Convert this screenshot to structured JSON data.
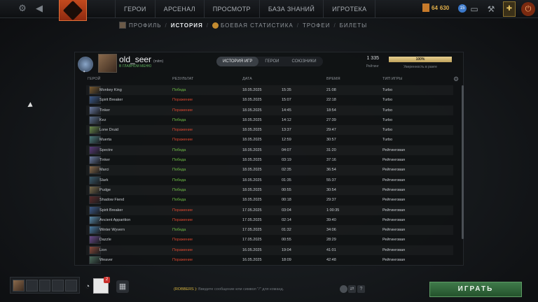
{
  "topbar": {
    "nav": [
      "ГЕРОИ",
      "АРСЕНАЛ",
      "ПРОСМОТР",
      "БАЗА ЗНАНИЙ",
      "ИГРОТЕКА"
    ],
    "gold_left": "64",
    "gold_right": "630",
    "level": "15"
  },
  "subnav": {
    "profile": "ПРОФИЛЬ",
    "history": "ИСТОРИЯ",
    "stats": "БОЕВАЯ СТАТИСТИКА",
    "trophies": "ТРОФЕИ",
    "tickets": "БИЛЕТЫ"
  },
  "profile": {
    "name": "old_seer",
    "tag": "(mitm)",
    "status": "В ГЛАВНОМ МЕНЮ",
    "rating_value": "1 335",
    "rating_label": "Рейтинг",
    "confidence_value": "100%",
    "confidence_fraction": 1.0,
    "confidence_label": "Уверенность в ранге"
  },
  "tabs": [
    "ИСТОРИЯ ИГР",
    "ГЕРОИ",
    "СОЮЗНИКИ"
  ],
  "table": {
    "headers": {
      "hero": "ГЕРОЙ",
      "result": "РЕЗУЛЬТАТ",
      "date": "ДАТА",
      "duration": "ВРЕМЯ",
      "type": "ТИП ИГРЫ"
    },
    "rows": [
      {
        "hero": "Monkey King",
        "result": "Победа",
        "win": true,
        "date": "18.05.2025",
        "time": "15:35",
        "duration": "21:08",
        "type": "Turbo",
        "color": "#7a5a2e"
      },
      {
        "hero": "Spirit Breaker",
        "result": "Поражение",
        "win": false,
        "date": "18.05.2025",
        "time": "15:07",
        "duration": "22:18",
        "type": "Turbo",
        "color": "#3c5a8a"
      },
      {
        "hero": "Tinker",
        "result": "Поражение",
        "win": false,
        "date": "18.05.2025",
        "time": "14:45",
        "duration": "18:54",
        "type": "Turbo",
        "color": "#6a7aa0"
      },
      {
        "hero": "Kez",
        "result": "Победа",
        "win": true,
        "date": "18.05.2025",
        "time": "14:12",
        "duration": "27:39",
        "type": "Turbo",
        "color": "#5a6c8a"
      },
      {
        "hero": "Lone Druid",
        "result": "Поражение",
        "win": false,
        "date": "18.05.2025",
        "time": "13:37",
        "duration": "29:47",
        "type": "Turbo",
        "color": "#6a8a4a"
      },
      {
        "hero": "Muerta",
        "result": "Поражение",
        "win": false,
        "date": "18.05.2025",
        "time": "12:59",
        "duration": "30:57",
        "type": "Turbo",
        "color": "#4a7a7a"
      },
      {
        "hero": "Spectre",
        "result": "Победа",
        "win": true,
        "date": "18.05.2025",
        "time": "04:07",
        "duration": "31:20",
        "type": "Рейтинговая",
        "color": "#5a3a7a"
      },
      {
        "hero": "Tinker",
        "result": "Победа",
        "win": true,
        "date": "18.05.2025",
        "time": "03:19",
        "duration": "37:16",
        "type": "Рейтинговая",
        "color": "#6a7aa0"
      },
      {
        "hero": "Marci",
        "result": "Победа",
        "win": true,
        "date": "18.05.2025",
        "time": "02:35",
        "duration": "36:54",
        "type": "Рейтинговая",
        "color": "#8a6a4a"
      },
      {
        "hero": "Slark",
        "result": "Победа",
        "win": true,
        "date": "18.05.2025",
        "time": "01:35",
        "duration": "55:37",
        "type": "Рейтинговая",
        "color": "#3a5a6a"
      },
      {
        "hero": "Pudge",
        "result": "Победа",
        "win": true,
        "date": "18.05.2025",
        "time": "00:55",
        "duration": "30:54",
        "type": "Рейтинговая",
        "color": "#7a6a4a"
      },
      {
        "hero": "Shadow Fiend",
        "result": "Победа",
        "win": true,
        "date": "18.05.2025",
        "time": "00:18",
        "duration": "29:37",
        "type": "Рейтинговая",
        "color": "#5a2a2a"
      },
      {
        "hero": "Spirit Breaker",
        "result": "Поражение",
        "win": false,
        "date": "17.05.2025",
        "time": "03:04",
        "duration": "1:00:35",
        "type": "Рейтинговая",
        "color": "#3c5a8a"
      },
      {
        "hero": "Ancient Apparition",
        "result": "Поражение",
        "win": false,
        "date": "17.05.2025",
        "time": "02:14",
        "duration": "39:40",
        "type": "Рейтинговая",
        "color": "#5a8aaa"
      },
      {
        "hero": "Winter Wyvern",
        "result": "Победа",
        "win": true,
        "date": "17.05.2025",
        "time": "01:32",
        "duration": "34:06",
        "type": "Рейтинговая",
        "color": "#4a7aa0"
      },
      {
        "hero": "Dazzle",
        "result": "Поражение",
        "win": false,
        "date": "17.05.2025",
        "time": "00:55",
        "duration": "28:29",
        "type": "Рейтинговая",
        "color": "#6a4a8a"
      },
      {
        "hero": "Lion",
        "result": "Поражение",
        "win": false,
        "date": "16.05.2025",
        "time": "19:04",
        "duration": "41:01",
        "type": "Рейтинговая",
        "color": "#8a4a3a"
      },
      {
        "hero": "Weaver",
        "result": "Поражение",
        "win": false,
        "date": "16.05.2025",
        "time": "18:09",
        "duration": "42:48",
        "type": "Рейтинговая",
        "color": "#4a6a5a"
      }
    ]
  },
  "bottom": {
    "notification_count": "2",
    "chat_channel": "(ROBBERS ):",
    "chat_placeholder": "Введите сообщение или символ \"/\" для команд.",
    "play_label": "ИГРАТЬ"
  },
  "icons": {
    "settings": "gear-icon",
    "back": "back-icon",
    "power": "power-icon"
  }
}
